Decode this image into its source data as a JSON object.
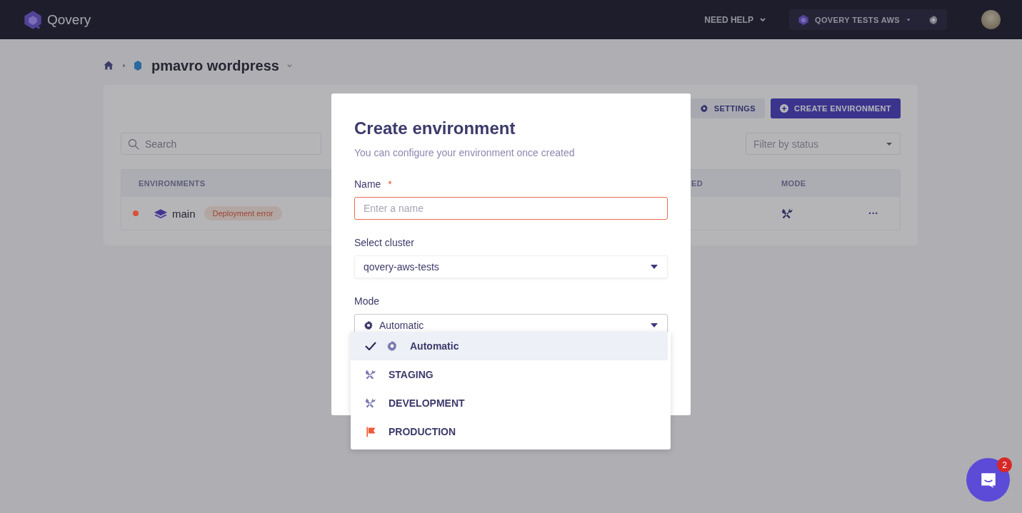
{
  "header": {
    "logo": "Qovery",
    "help": "NEED HELP",
    "organization": "QOVERY TESTS AWS"
  },
  "breadcrumb": {
    "project": "pmavro wordpress"
  },
  "toolbar": {
    "buttons": [
      {
        "label": "SETTINGS",
        "kind": "secondary"
      },
      {
        "label": "CREATE ENVIRONMENT",
        "kind": "primary"
      }
    ],
    "search": {
      "placeholder": "Search"
    },
    "filter": {
      "placeholder": "Filter by status"
    }
  },
  "table": {
    "columns": [
      "ENVIRONMENTS",
      "ED",
      "MODE"
    ],
    "rows": [
      {
        "name": "main",
        "color": "#d9503a",
        "badge": "Deployment error",
        "more": "···"
      }
    ]
  },
  "modal": {
    "title": "Create environment",
    "subtitle": "You can configure your environment once created",
    "fields": [
      {
        "kind": "text",
        "label": "Name",
        "required_mark": "*",
        "placeholder": "Enter a name",
        "invalid": true
      },
      {
        "kind": "select",
        "label": "Select cluster",
        "value": "qovery-aws-tests"
      },
      {
        "kind": "mode_select",
        "label": "Mode",
        "value": "Automatic"
      }
    ]
  },
  "dropdown": {
    "options": [
      {
        "label": "Automatic",
        "selected": true,
        "kind": "automatic"
      },
      {
        "label": "STAGING",
        "selected": false,
        "kind": "staging"
      },
      {
        "label": "DEVELOPMENT",
        "selected": false,
        "kind": "development"
      },
      {
        "label": "PRODUCTION",
        "selected": false,
        "kind": "production"
      }
    ]
  },
  "chat": {
    "badge": "2"
  }
}
